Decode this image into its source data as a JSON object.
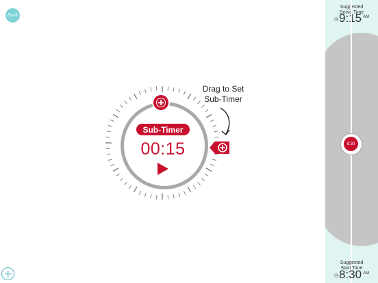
{
  "app": {
    "logo_text": "Dash"
  },
  "timer": {
    "pill_label": "Sub-Timer",
    "time": "00:15",
    "drag_hint_line1": "Drag to Set",
    "drag_hint_line2": "Sub-Timer"
  },
  "panel": {
    "serve_label_line1": "Suggested",
    "serve_label_line2": "Serve Time",
    "serve_time": "9:15",
    "serve_ampm": "AM",
    "start_label_line1": "Suggested",
    "start_label_line2": "Start Time",
    "start_time": "8:30",
    "start_ampm": "AM",
    "marker_time": "8:30"
  },
  "colors": {
    "accent": "#c8102e",
    "teal": "#49b5c0",
    "panel_bg": "#e0f4f1",
    "ring": "#a9a9a9"
  },
  "icons": {
    "add": "plus-circle-icon",
    "play": "play-icon",
    "clock": "clock-icon"
  }
}
